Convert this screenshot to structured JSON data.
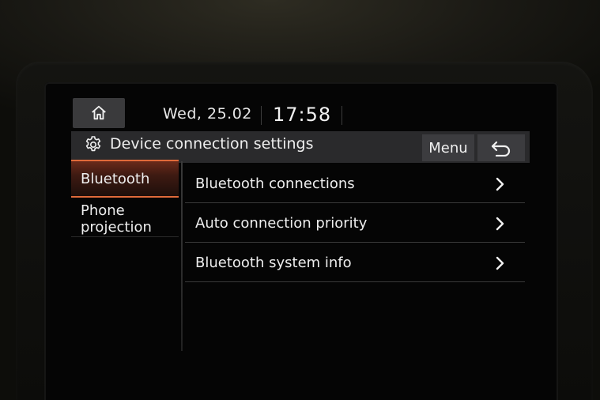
{
  "status_bar": {
    "date": "Wed, 25.02",
    "time": "17:58"
  },
  "header": {
    "title": "Device connection settings",
    "menu_label": "Menu"
  },
  "tabs": [
    {
      "label": "Bluetooth",
      "selected": true
    },
    {
      "label_line1": "Phone",
      "label_line2": "projection",
      "selected": false
    }
  ],
  "list": [
    {
      "label": "Bluetooth connections"
    },
    {
      "label": "Auto connection priority"
    },
    {
      "label": "Bluetooth system info"
    }
  ],
  "colors": {
    "accent": "#e06a3a",
    "bar": "#2a2a2c",
    "button": "#3c3c3f",
    "text": "#eeeeee"
  },
  "icons": {
    "home": "home-icon",
    "settings": "gear-icon",
    "back": "back-arrow-icon",
    "chevron": "chevron-right-icon"
  }
}
